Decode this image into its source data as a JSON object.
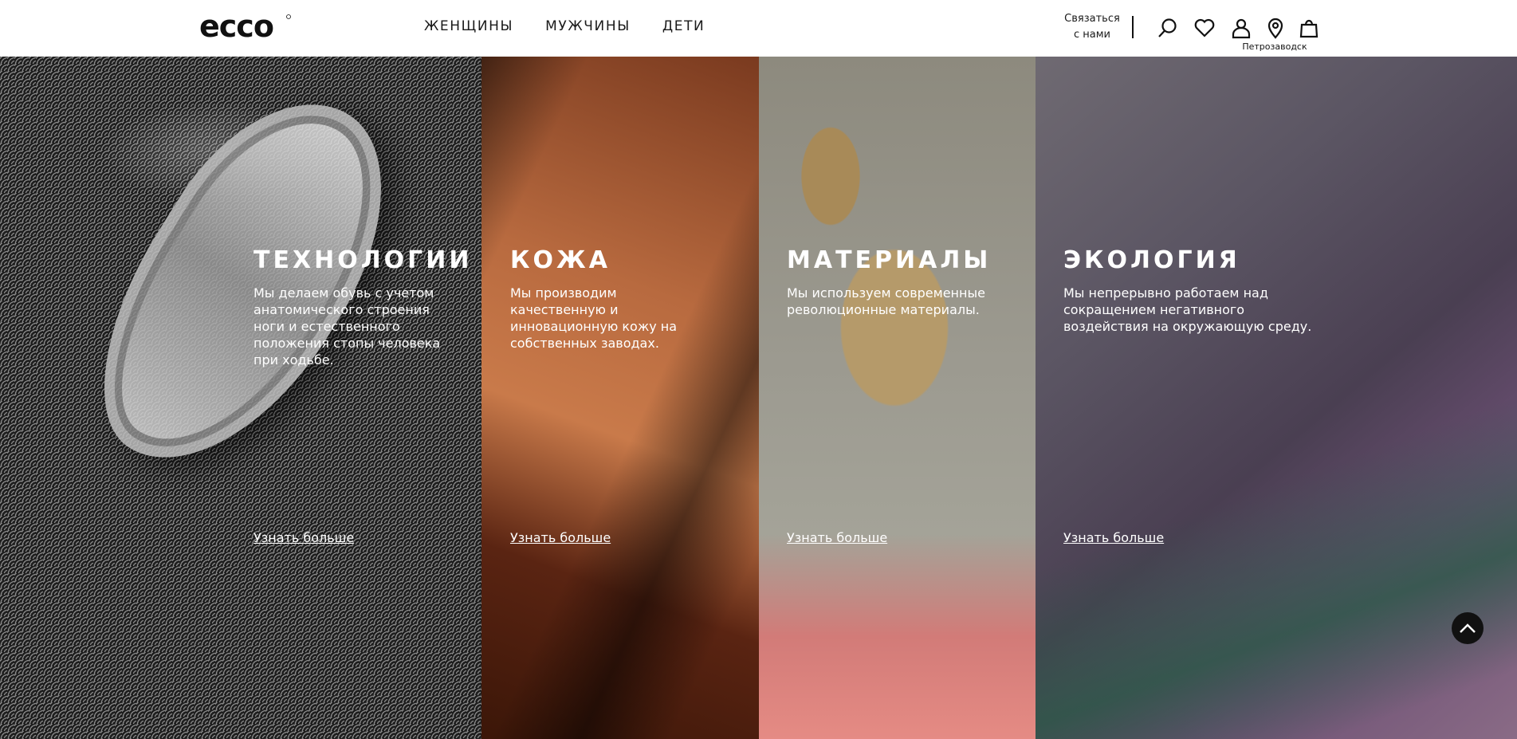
{
  "brand": {
    "logo_text": "ecco"
  },
  "nav": {
    "items": [
      {
        "label": "ЖЕНЩИНЫ"
      },
      {
        "label": "МУЖЧИНЫ"
      },
      {
        "label": "ДЕТИ"
      }
    ]
  },
  "header": {
    "contact_line1": "Связаться",
    "contact_line2": "с нами",
    "city": "Петрозаводск",
    "icons": [
      "search-icon",
      "heart-icon",
      "user-icon",
      "location-pin-icon",
      "shopping-bag-icon"
    ]
  },
  "panels": [
    {
      "title": "ТЕХНОЛОГИИ",
      "description": "Мы делаем обувь с учетом анатомического строения ноги и естественного положения стопы человека при ходьбе.",
      "link": "Узнать больше"
    },
    {
      "title": "КОЖА",
      "description": "Мы производим качественную и инновационную кожу на собственных заводах.",
      "link": "Узнать больше"
    },
    {
      "title": "МАТЕРИАЛЫ",
      "description": "Мы используем современные революционные материалы.",
      "link": "Узнать больше"
    },
    {
      "title": "ЭКОЛОГИЯ",
      "description": "Мы непрерывно работаем над сокращением негативного воздействия на окружающую среду.",
      "link": "Узнать больше"
    }
  ],
  "scroll_top": {
    "icon": "chevron-up-icon"
  },
  "colors": {
    "header_bg": "#ffffff",
    "text_dark": "#111111",
    "panel_text": "#ffffff",
    "scroll_button": "#111111"
  }
}
